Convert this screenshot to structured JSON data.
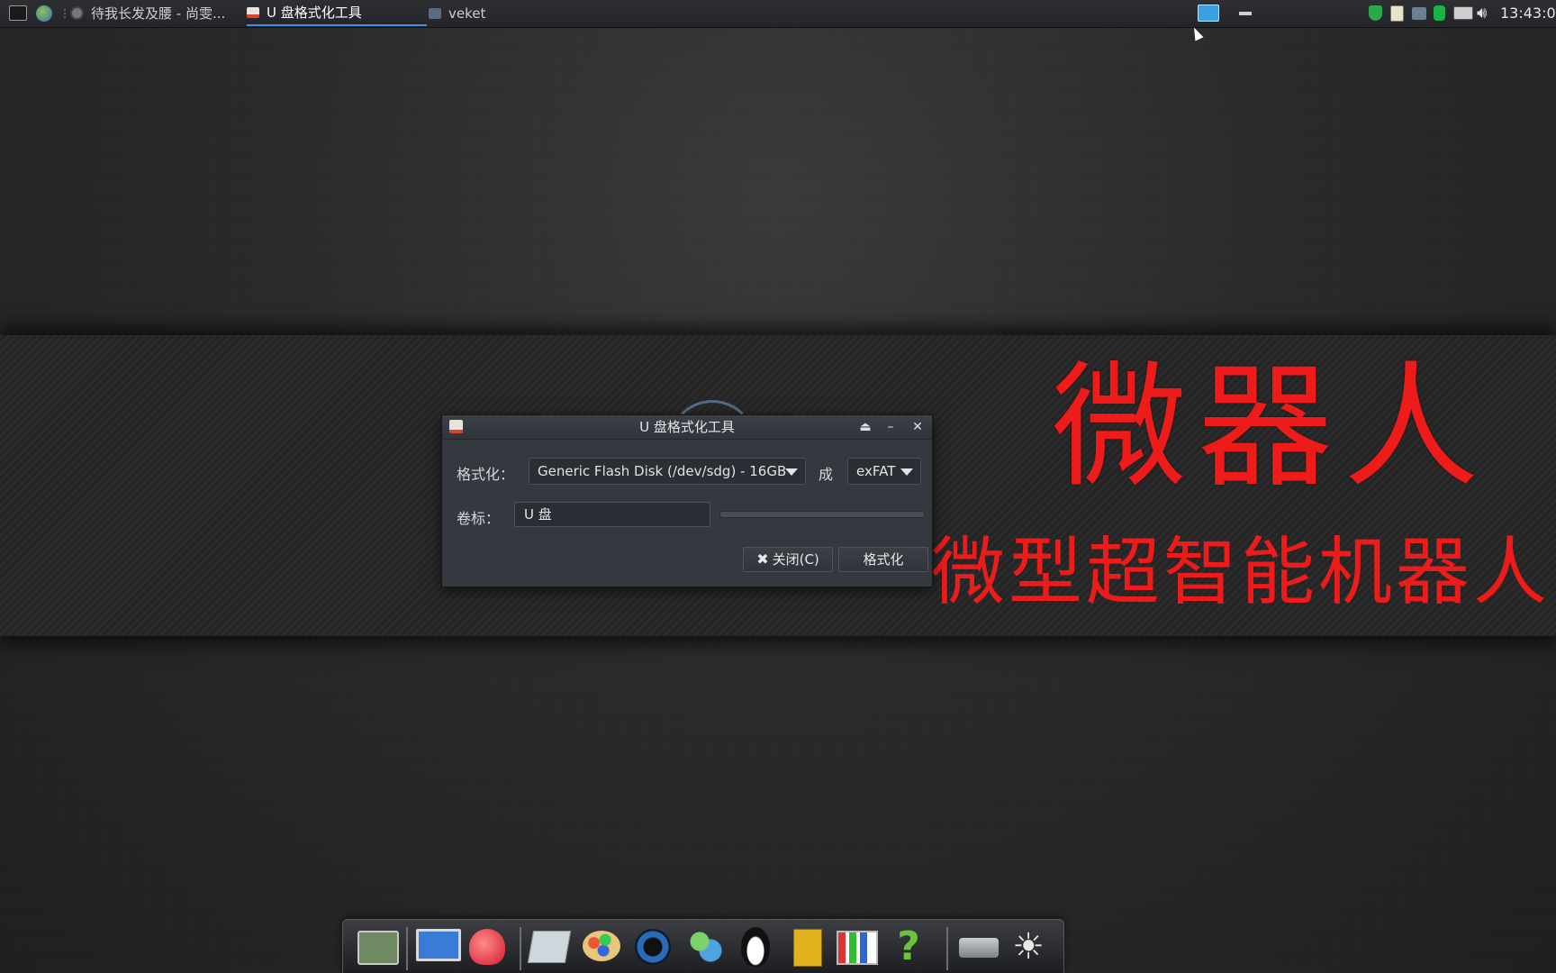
{
  "topbar": {
    "tasks": [
      {
        "label": "待我长发及腰 - 尚雯...",
        "active": false
      },
      {
        "label": "U 盘格式化工具",
        "active": true
      },
      {
        "label": "veket",
        "active": false
      }
    ],
    "clock": "13:43:0"
  },
  "desktop": {
    "banner_title": "微器人",
    "banner_subtitle": "微型超智能机器人"
  },
  "dialog": {
    "title": "U 盘格式化工具",
    "format_label": "格式化：",
    "device_value": "Generic Flash Disk (/dev/sdg) - 16GB",
    "to_label": "成",
    "fs_value": "exFAT",
    "volume_label": "卷标：",
    "volume_value": "U 盘",
    "progress": 0,
    "close_button": "关闭(C)",
    "format_button": "格式化",
    "close_icon_glyph": "✖"
  },
  "dock": {
    "icons": [
      "desktop-settings-icon",
      "computer-icon",
      "squirrel-icon",
      "text-editor-icon",
      "paint-icon",
      "media-player-icon",
      "chat-icon",
      "qq-penguin-icon",
      "contacts-icon",
      "chart-icon",
      "help-icon",
      "drive-icon",
      "brightness-icon"
    ]
  },
  "colors": {
    "accent": "#3f8ee8",
    "banner_red": "#ee1b1b"
  }
}
